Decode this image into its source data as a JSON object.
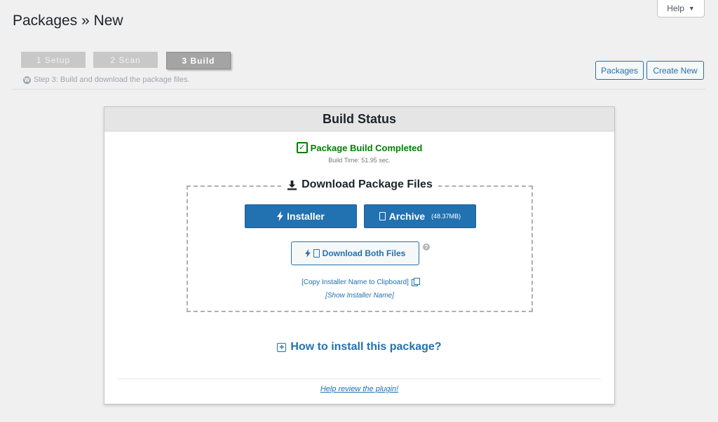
{
  "header": {
    "title": "Packages » New",
    "help_label": "Help",
    "help_caret": "▼"
  },
  "steps": {
    "items": [
      {
        "label": "1 Setup",
        "state": "done"
      },
      {
        "label": "2 Scan",
        "state": "done"
      },
      {
        "label": "3 Build",
        "state": "active"
      }
    ],
    "description": "Step 3: Build and download the package files.",
    "description_icon": "wordpress-icon"
  },
  "toolbar": {
    "packages_label": "Packages",
    "create_new_label": "Create New"
  },
  "build_panel": {
    "title": "Build Status",
    "status_text": "Package Build Completed",
    "status_color": "#008000",
    "build_time": "Build Time: 51.95 sec.",
    "download": {
      "title": "Download Package Files",
      "installer_label": "Installer",
      "archive_label": "Archive",
      "archive_size": "(48.37MB)",
      "both_label": "Download Both Files",
      "help_mark": "?",
      "copy_link": "[Copy Installer Name to Clipboard]",
      "show_link": "[Show Installer Name]"
    },
    "howto_label": "How to install this package?",
    "review_label": "Help review the plugin!"
  },
  "colors": {
    "accent": "#2271b1",
    "background": "#f0f0f1"
  }
}
